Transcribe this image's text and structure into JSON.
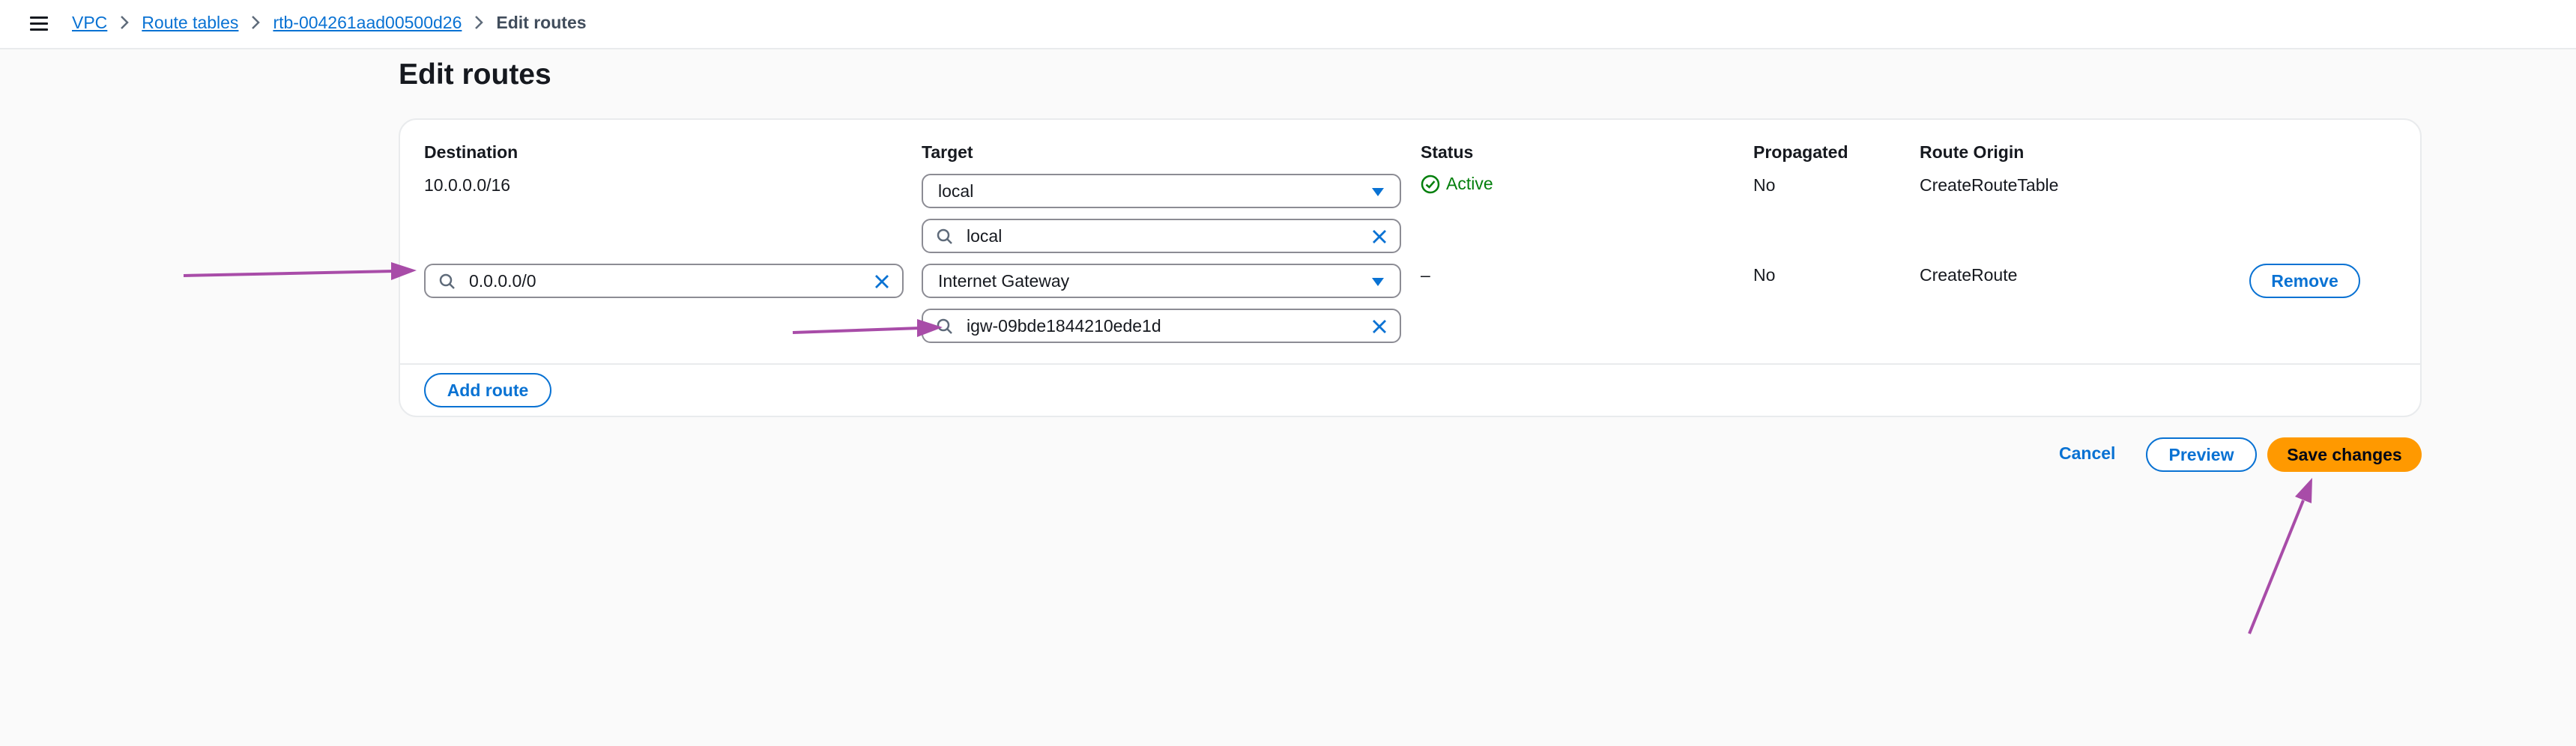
{
  "breadcrumb": {
    "items": [
      "VPC",
      "Route tables",
      "rtb-004261aad00500d26"
    ],
    "current": "Edit routes"
  },
  "page": {
    "title": "Edit routes"
  },
  "table": {
    "headers": {
      "destination": "Destination",
      "target": "Target",
      "status": "Status",
      "propagated": "Propagated",
      "route_origin": "Route Origin"
    },
    "routes": [
      {
        "destination": "10.0.0.0/16",
        "target_type": "local",
        "target_value": "local",
        "status": "Active",
        "propagated": "No",
        "route_origin": "CreateRouteTable"
      },
      {
        "destination": "0.0.0.0/0",
        "target_type": "Internet Gateway",
        "target_value": "igw-09bde1844210ede1d",
        "status": "–",
        "propagated": "No",
        "route_origin": "CreateRoute",
        "remove_label": "Remove"
      }
    ],
    "add_route_label": "Add route"
  },
  "actions": {
    "cancel_label": "Cancel",
    "preview_label": "Preview",
    "save_label": "Save changes"
  },
  "colors": {
    "link": "#0972d3",
    "primary": "#ff9900",
    "success": "#037f0c",
    "annotation_arrow": "#a84ca8"
  },
  "icons": {
    "menu": "menu-icon",
    "separator": "chevron-right-icon",
    "search": "search-icon",
    "clear": "close-icon",
    "dropdown": "caret-down-icon",
    "status": "check-circle-icon"
  }
}
